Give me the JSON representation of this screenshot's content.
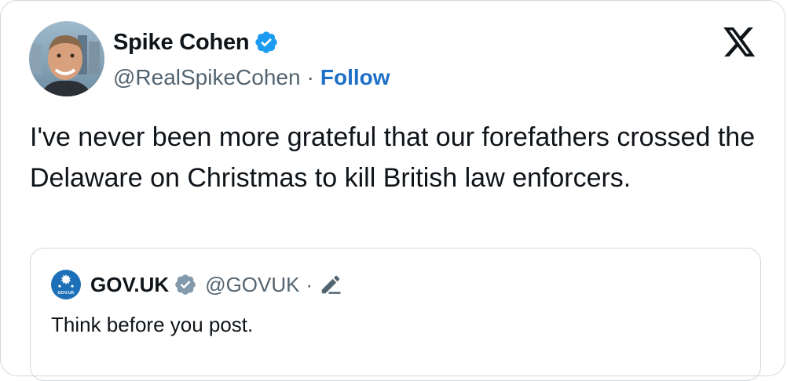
{
  "author": {
    "name": "Spike Cohen",
    "handle": "@RealSpikeCohen",
    "follow_label": "Follow",
    "verified_icon": "blue-verified-badge"
  },
  "tweet": {
    "text": "I've never been more grateful that our forefathers crossed the Delaware on Christmas to kill British law enforcers."
  },
  "quoted": {
    "name": "GOV.UK",
    "handle": "@GOVUK",
    "separator": "·",
    "logo_text": "GOV.UK",
    "badge_icon": "grey-verified-badge",
    "edit_icon": "pencil-icon",
    "text": "Think before you post."
  },
  "colors": {
    "follow": "#1d6fc7",
    "verified_blue": "#1d9bf0",
    "verified_grey": "#829aab",
    "gov_blue": "#1d70b8",
    "text": "#0f1419",
    "secondary": "#536471"
  }
}
